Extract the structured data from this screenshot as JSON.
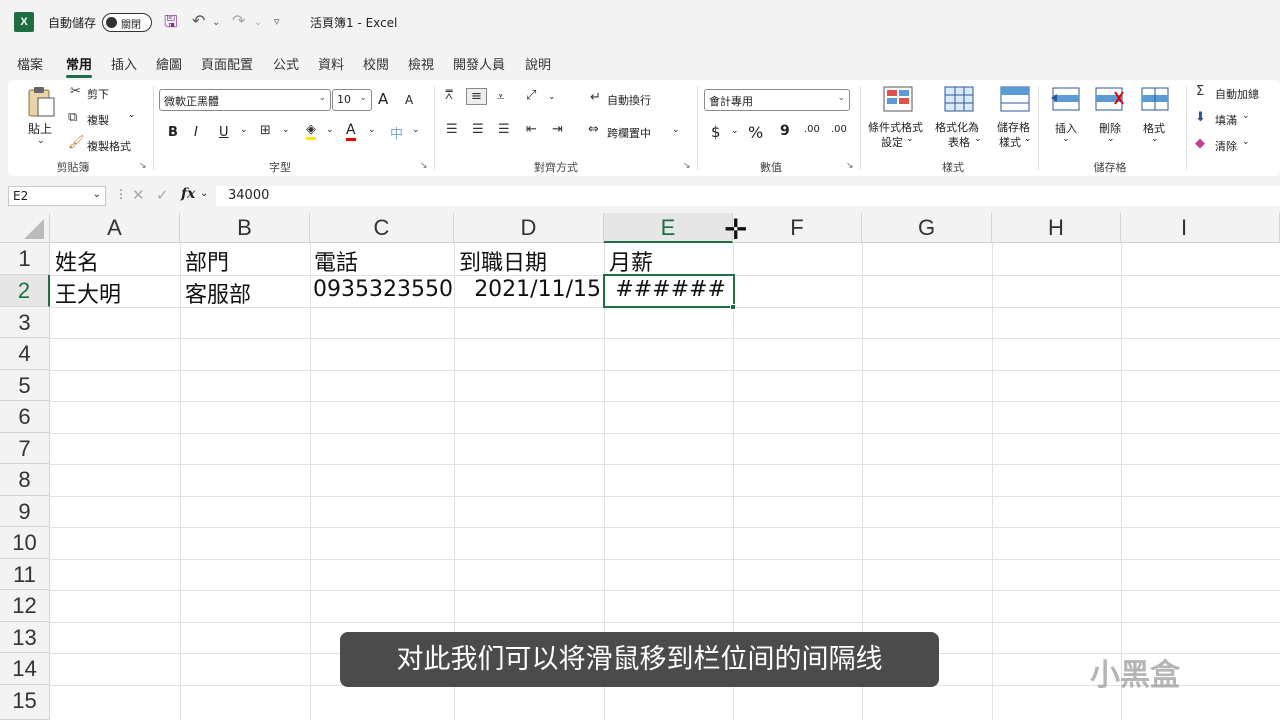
{
  "titlebar": {
    "app_icon": "X",
    "autosave_label": "自動儲存",
    "autosave_state": "關閉",
    "doc_title": "活頁簿1  -  Excel"
  },
  "menu": {
    "tabs": [
      "檔案",
      "常用",
      "插入",
      "繪圖",
      "頁面配置",
      "公式",
      "資料",
      "校閱",
      "檢視",
      "開發人員",
      "說明"
    ],
    "active": "常用"
  },
  "ribbon": {
    "clipboard": {
      "paste": "貼上",
      "cut": "剪下",
      "copy": "複製",
      "format_painter": "複製格式",
      "label": "剪貼簿"
    },
    "font": {
      "font_name": "微軟正黑體",
      "font_size": "10",
      "grow": "A",
      "shrink": "A",
      "bold": "B",
      "italic": "I",
      "underline": "U",
      "font_color_letter": "A",
      "label": "字型"
    },
    "alignment": {
      "wrap_text": "自動換行",
      "merge_center": "跨欄置中",
      "label": "對齊方式"
    },
    "number": {
      "format": "會計專用",
      "currency": "$",
      "percent": "%",
      "comma": "9",
      "inc_decimal": ".00",
      "dec_decimal": ".00",
      "label": "數值"
    },
    "styles": {
      "conditional_line1": "條件式格式",
      "conditional_line2": "設定",
      "as_table_line1": "格式化為",
      "as_table_line2": "表格",
      "cell_styles_line1": "儲存格",
      "cell_styles_line2": "樣式",
      "label": "樣式"
    },
    "cells": {
      "insert": "插入",
      "delete": "刪除",
      "format": "格式",
      "label": "儲存格"
    },
    "editing": {
      "autosum": "自動加總",
      "fill": "填滿",
      "clear": "清除"
    }
  },
  "formula_bar": {
    "name_box": "E2",
    "fx": "fx",
    "value": "34000"
  },
  "grid": {
    "columns": [
      "A",
      "B",
      "C",
      "D",
      "E",
      "F",
      "G",
      "H",
      "I"
    ],
    "rows": [
      "1",
      "2",
      "3",
      "4",
      "5",
      "6",
      "7",
      "8",
      "9",
      "10",
      "11",
      "12",
      "13",
      "14",
      "15"
    ],
    "selected_column": "E",
    "selected_row": "2",
    "cells": {
      "A1": "姓名",
      "B1": "部門",
      "C1": "電話",
      "D1": "到職日期",
      "E1": "月薪",
      "A2": "王大明",
      "B2": "客服部",
      "C2": "0935323550",
      "D2": "2021/11/15",
      "E2": "######"
    }
  },
  "subtitle": "对此我们可以将滑鼠移到栏位间的间隔线",
  "watermark": "小黑盒",
  "colors": {
    "accent": "#1d6f42"
  }
}
